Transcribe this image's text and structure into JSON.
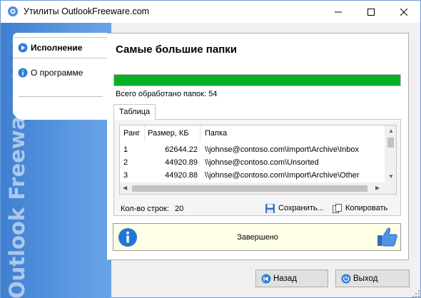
{
  "window": {
    "title": "Утилиты OutlookFreeware.com",
    "icon": "gear-icon",
    "controls": [
      "minimize-icon",
      "maximize-icon",
      "close-icon"
    ]
  },
  "sidebar": {
    "watermark": "Outlook Freeware.com",
    "items": [
      {
        "label": "Исполнение",
        "icon": "play-icon",
        "active": true
      },
      {
        "label": "О программе",
        "icon": "info-icon",
        "active": false
      }
    ]
  },
  "main": {
    "title": "Самые большие папки",
    "progress_fraction": 1.0,
    "progress_color": "#06b025",
    "processed_text": "Всего обработано папок: 54",
    "tab_label": "Таблица",
    "table": {
      "columns": [
        "Ранг",
        "Размер, КБ",
        "Папка"
      ],
      "rows": [
        [
          "1",
          "62644.22",
          "\\\\johnse@contoso.com\\Import\\Archive\\Inbox"
        ],
        [
          "2",
          "44920.89",
          "\\\\johnse@contoso.com\\Unsorted"
        ],
        [
          "3",
          "44920.88",
          "\\\\johnse@contoso.com\\Import\\Archive\\Other"
        ]
      ]
    },
    "row_count_label": "Кол-во строк:",
    "row_count_value": "20",
    "save_label": "Сохранить...",
    "copy_label": "Копировать",
    "status_text": "Завершено",
    "status_icons": [
      "info-icon",
      "thumbs-up-icon"
    ],
    "status_bg": "#ffffe8"
  },
  "buttons": {
    "back_label": "Назад",
    "exit_label": "Выход"
  }
}
